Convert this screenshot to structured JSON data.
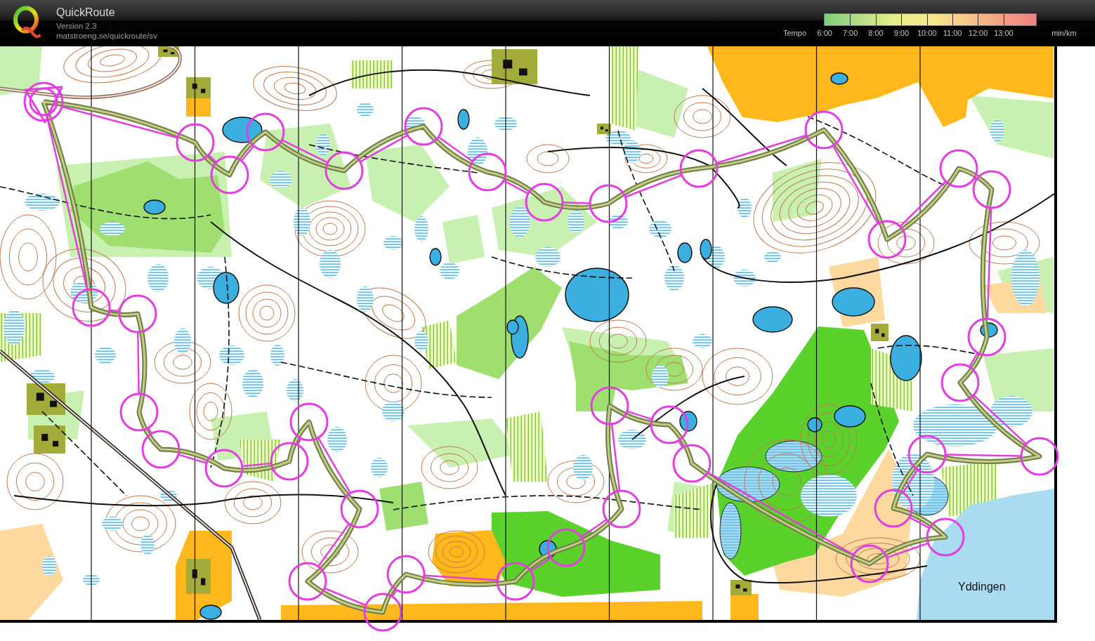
{
  "header": {
    "app_name": "QuickRoute",
    "version": "Version 2.3",
    "url": "matstroeng.se/quickroute/sv"
  },
  "tempo_legend": {
    "label": "Tempo",
    "ticks": [
      "6:00",
      "7:00",
      "8:00",
      "9:00",
      "10:00",
      "11:00",
      "12:00",
      "13:00"
    ],
    "unit": "min/km"
  },
  "map": {
    "place_label": "Yddingen"
  }
}
